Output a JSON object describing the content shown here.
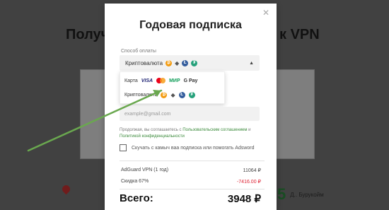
{
  "background": {
    "title_left": "Получ",
    "title_right": "к VPN",
    "bottom_right_number": "5",
    "bottom_right_text": "Д.. Бурукойм"
  },
  "modal": {
    "title": "Годовая подписка",
    "payment_label": "Способ оплаты",
    "selected_method": "Криптовалюта",
    "dropdown": {
      "options": [
        {
          "label": "Карта",
          "icons": [
            "visa-icon",
            "mastercard-icon",
            "mir-icon",
            "google-pay-icon"
          ],
          "visa": "VISA",
          "mir": "МИР",
          "gpay": "G Pay"
        },
        {
          "label": "Криптовалюта",
          "icons": [
            "bitcoin-icon",
            "ethereum-icon",
            "litecoin-icon",
            "tether-icon"
          ]
        }
      ]
    },
    "email_placeholder": "example@gmail.com",
    "consent_text": "Продолжая, вы соглашаетесь с ",
    "consent_link1": "Пользовательским соглашением",
    "consent_and": " и ",
    "consent_link2": "Политикой конфиденциальности",
    "checkbox_label": "Скучать с камыч ваа подписка или помогать Adsword",
    "line_items": [
      {
        "label": "AdGuard VPN (1 год)",
        "value": "11064 ₽"
      },
      {
        "label": "Скидка 67%",
        "value": "-7416.00 ₽"
      }
    ],
    "total_label": "Всего:",
    "total_value": "3948 ₽"
  },
  "colors": {
    "accent_green": "#3a8a3a",
    "discount_red": "#d23333",
    "arrow_green": "#6aa84f"
  }
}
